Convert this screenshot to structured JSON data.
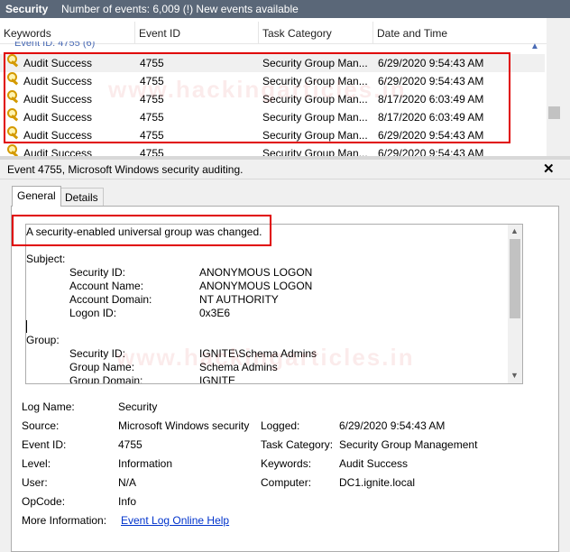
{
  "titlebar": {
    "title": "Security",
    "status": "Number of events: 6,009 (!) New events available"
  },
  "grid": {
    "columns": [
      "Keywords",
      "Event ID",
      "Task Category",
      "Date and Time"
    ],
    "group_partial": "Event ID: 4755 (6)",
    "rows": [
      {
        "keyword": "Audit Success",
        "event_id": "4755",
        "task": "Security Group Man...",
        "date": "6/29/2020 9:54:43 AM"
      },
      {
        "keyword": "Audit Success",
        "event_id": "4755",
        "task": "Security Group Man...",
        "date": "6/29/2020 9:54:43 AM"
      },
      {
        "keyword": "Audit Success",
        "event_id": "4755",
        "task": "Security Group Man...",
        "date": "8/17/2020 6:03:49 AM"
      },
      {
        "keyword": "Audit Success",
        "event_id": "4755",
        "task": "Security Group Man...",
        "date": "8/17/2020 6:03:49 AM"
      },
      {
        "keyword": "Audit Success",
        "event_id": "4755",
        "task": "Security Group Man...",
        "date": "6/29/2020 9:54:43 AM"
      },
      {
        "keyword": "Audit Success",
        "event_id": "4755",
        "task": "Security Group Man...",
        "date": "6/29/2020 9:54:43 AM"
      }
    ]
  },
  "detail": {
    "header": "Event 4755, Microsoft Windows security auditing.",
    "tabs": [
      "General",
      "Details"
    ],
    "message": {
      "headline": "A security-enabled universal group was changed.",
      "subject_label": "Subject:",
      "subject": [
        {
          "k": "Security ID:",
          "v": "ANONYMOUS LOGON"
        },
        {
          "k": "Account Name:",
          "v": "ANONYMOUS LOGON"
        },
        {
          "k": "Account Domain:",
          "v": "NT AUTHORITY"
        },
        {
          "k": "Logon ID:",
          "v": "0x3E6"
        }
      ],
      "group_label": "Group:",
      "group": [
        {
          "k": "Security ID:",
          "v": "IGNITE\\Schema Admins"
        },
        {
          "k": "Group Name:",
          "v": "Schema Admins"
        },
        {
          "k": "Group Domain:",
          "v": "IGNITE"
        }
      ]
    },
    "props": {
      "log_name_k": "Log Name:",
      "log_name_v": "Security",
      "source_k": "Source:",
      "source_v": "Microsoft Windows security",
      "logged_k": "Logged:",
      "logged_v": "6/29/2020 9:54:43 AM",
      "event_id_k": "Event ID:",
      "event_id_v": "4755",
      "task_k": "Task Category:",
      "task_v": "Security Group Management",
      "level_k": "Level:",
      "level_v": "Information",
      "keywords_k": "Keywords:",
      "keywords_v": "Audit Success",
      "user_k": "User:",
      "user_v": "N/A",
      "computer_k": "Computer:",
      "computer_v": "DC1.ignite.local",
      "opcode_k": "OpCode:",
      "opcode_v": "Info",
      "more_k": "More Information:",
      "more_link": "Event Log Online Help"
    }
  },
  "watermark": "www.hackingarticles.in",
  "colors": {
    "highlight": "#e00000",
    "titlebar": "#5a6778",
    "link": "#0033cc",
    "key": "#d49a00"
  }
}
